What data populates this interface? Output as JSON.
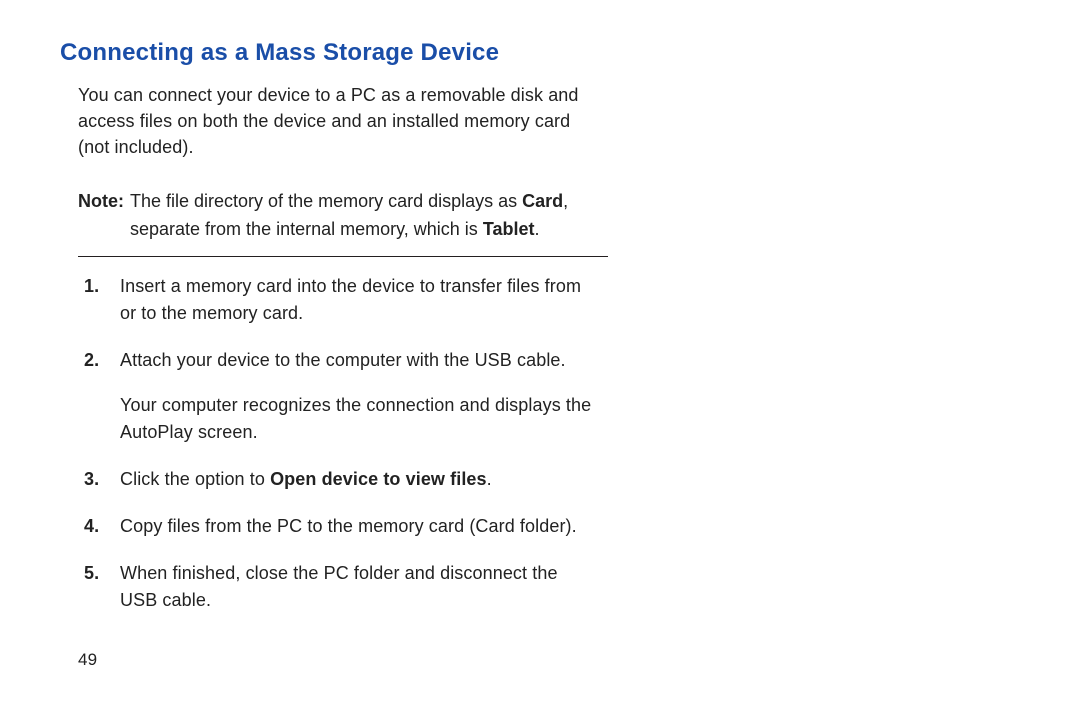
{
  "heading": "Connecting as a Mass Storage Device",
  "intro": "You can connect your device to a PC as a removable disk and access files on both the device and an installed memory card (not included).",
  "note": {
    "label": "Note:",
    "pre": "The file directory of the memory card displays as ",
    "card": "Card",
    "mid": ", separate from the internal memory, which is ",
    "tablet": "Tablet",
    "post": "."
  },
  "steps": {
    "s1": "Insert a memory card into the device to transfer files from or to the memory card.",
    "s2a": "Attach your device to the computer with the USB cable.",
    "s2b": "Your computer recognizes the connection and displays the AutoPlay screen.",
    "s3_pre": "Click the option to ",
    "s3_bold": "Open device to view files",
    "s3_post": ".",
    "s4": "Copy files from the PC to the memory card (Card folder).",
    "s5": "When finished, close the PC folder and disconnect the USB cable."
  },
  "page_number": "49"
}
